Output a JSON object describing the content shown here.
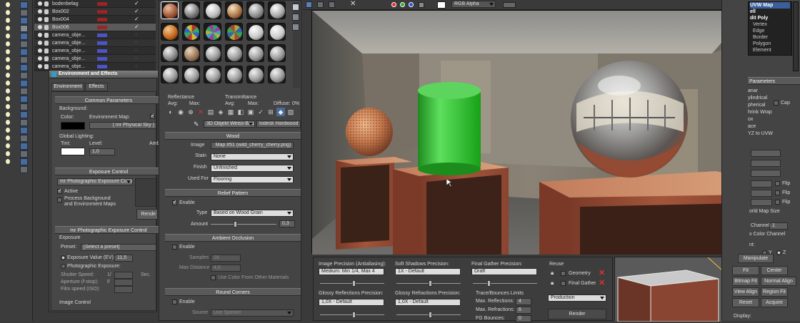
{
  "layer_list": {
    "rows": [
      {
        "name": "bodenbelag",
        "color": "#9b2424",
        "checked": true
      },
      {
        "name": "Box002",
        "color": "#9b2424",
        "checked": true
      },
      {
        "name": "Box004",
        "color": "#9b2424",
        "checked": true
      },
      {
        "name": "Box006",
        "color": "#9b2424",
        "checked": true
      },
      {
        "name": "camera_obje...",
        "color": "#4b55c9",
        "checked": false
      },
      {
        "name": "camera_obje...",
        "color": "#4b55c9",
        "checked": false
      },
      {
        "name": "camera_obje...",
        "color": "#4b55c9",
        "checked": false
      },
      {
        "name": "camera_obje...",
        "color": "#4b55c9",
        "checked": false
      },
      {
        "name": "camera_obje...",
        "color": "#4b55c9",
        "checked": false
      }
    ]
  },
  "env": {
    "title": "Environment and Effects",
    "tabs": [
      "Environment",
      "Effects"
    ],
    "common_header": "Common Parameters",
    "background_label": "Background:",
    "color_label": "Color:",
    "env_map_label": "Environment Map:",
    "env_map_value": "( mr Physical Sky )",
    "global_label": "Global Lighting:",
    "tint_label": "Tint:",
    "level_label": "Level:",
    "level_value": "1,0",
    "ambient_label": "Amb",
    "exposure_header": "Exposure Control",
    "exposure_select": "mr Photographic Exposure Contro",
    "active_label": "Active",
    "process_label": "Process Background\nand Environment Maps",
    "render_btn": "Rende",
    "photo_header": "mr Photographic Exposure Control",
    "exposure_group": "Exposure",
    "preset_label": "Preset:",
    "preset_value": "[Select a preset]",
    "ev_label": "Exposure Value (EV):",
    "ev_value": "11,5",
    "photo_exp_label": "Photographic Exposure:",
    "shutter_label": "Shutter Speed:",
    "shutter_prefix": "1/",
    "shutter_unit": "Sec.",
    "aperture_label": "Aperture (f-stop):",
    "aperture_prefix": "f/",
    "film_label": "Film speed (ISO):",
    "image_control": "Image Control"
  },
  "material": {
    "reflectance_label": "Reflectance",
    "avg_label": "Avg:",
    "max_label": "Max:",
    "transmittance_label": "Transmittance",
    "diffuse_label": "Diffuse:",
    "diffuse_value": "0%",
    "material_name": "3D Objekt Weiss-Basis",
    "material_type": "todesk Hardwood",
    "wood_header": "Wood",
    "image_label": "Image",
    "image_value": "Map #51 (wild_cherry_cherry.png)",
    "stain_label": "Stain",
    "stain_value": "None",
    "finish_label": "Finish",
    "finish_value": "Unfinished",
    "used_for_label": "Used For",
    "used_for_value": "Flooring",
    "relief_header": "Relief Pattern",
    "enable_label": "Enable",
    "type_label": "Type",
    "type_value": "Based on Wood Grain",
    "amount_label": "Amount",
    "amount_value": "0,3",
    "ao_header": "Ambient Occlusion",
    "samples_label": "Samples",
    "samples_value": "16",
    "max_distance_label": "Max Distance",
    "max_distance_value": "4,0",
    "use_color_label": "Use Color From Other Materials",
    "round_header": "Round Corners",
    "source_label": "Source",
    "source_value": "Use Spinner"
  },
  "frame_window": {
    "channel_select": "RGB Alpha"
  },
  "render_settings": {
    "image_precision_label": "Image Precision (Antialiasing):",
    "image_precision_value": "Medium: Min 1/4, Max 4",
    "soft_shadows_label": "Soft Shadows Precision:",
    "soft_shadows_value": "1X - Default",
    "final_gather_label": "Final Gather Precision:",
    "final_gather_value": "Draft",
    "glossy_refl_label": "Glossy Reflections Precision:",
    "glossy_refl_value": "1,0X - Default",
    "glossy_refr_label": "Glossy Refractions Precision:",
    "glossy_refr_value": "1,0X - Default",
    "trace_label": "Trace/Bounces Limits",
    "max_reflections_label": "Max. Reflections:",
    "max_reflections_value": "4",
    "max_refractions_label": "Max. Refractions:",
    "max_refractions_value": "6",
    "fg_bounces_label": "FG Bounces:",
    "fg_bounces_value": "0",
    "reuse_label": "Reuse",
    "geometry_label": "Geometry",
    "final_gather_reuse_label": "Final Gather",
    "production_value": "Production",
    "render_btn": "Render"
  },
  "modifier_panel": {
    "items": [
      "UVW Map",
      "ell",
      "dit Poly",
      "Vertex",
      "Edge",
      "Border",
      "Polygon",
      "Element"
    ],
    "params_header": "Parameters",
    "mapping": [
      "anar",
      "ylindrical",
      "pherical",
      "hrink Wrap",
      "ox",
      "ace",
      "YZ to UVW"
    ],
    "cap_label": "Cap",
    "flip_labels": [
      "Flip",
      "Flip",
      "Flip"
    ],
    "world_map_size": "orld Map Size",
    "channel_label": "Channel:",
    "channel_value": "1",
    "color_channel": "x Color Channel",
    "axis_label": "nt:",
    "axis_options": [
      "Y",
      "Z"
    ],
    "manipulate": "Manipulate",
    "fit": "Fit",
    "center": "Center",
    "bitmap_fit": "Bitmap Fit",
    "normal_align": "Normal Align",
    "view_align": "View Align",
    "region_fit": "Region Fit",
    "reset": "Reset",
    "acquire": "Acquire",
    "display_label": "Display:"
  }
}
